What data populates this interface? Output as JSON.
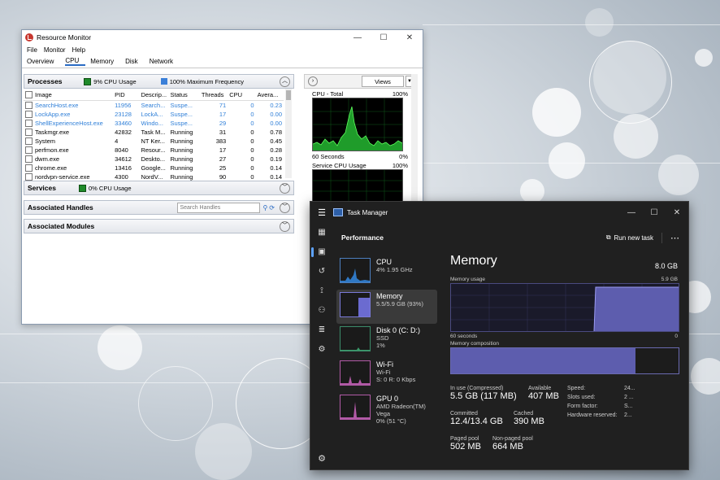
{
  "resource_monitor": {
    "title": "Resource Monitor",
    "window_buttons": [
      "—",
      "☐",
      "✕"
    ],
    "menu": [
      "File",
      "Monitor",
      "Help"
    ],
    "tabs": [
      "Overview",
      "CPU",
      "Memory",
      "Disk",
      "Network"
    ],
    "active_tab": "CPU",
    "processes": {
      "label": "Processes",
      "cpu_usage": "9% CPU Usage",
      "max_freq": "100% Maximum Frequency",
      "columns": [
        "Image",
        "PID",
        "Descrip...",
        "Status",
        "Threads",
        "CPU",
        "Avera..."
      ],
      "rows": [
        {
          "image": "SearchHost.exe",
          "pid": "11956",
          "desc": "Search...",
          "status": "Suspe...",
          "threads": "71",
          "cpu": "0",
          "avg": "0.23",
          "suspended": true
        },
        {
          "image": "LockApp.exe",
          "pid": "23128",
          "desc": "LockA...",
          "status": "Suspe...",
          "threads": "17",
          "cpu": "0",
          "avg": "0.00",
          "suspended": true
        },
        {
          "image": "ShellExperienceHost.exe",
          "pid": "33460",
          "desc": "Windo...",
          "status": "Suspe...",
          "threads": "29",
          "cpu": "0",
          "avg": "0.00",
          "suspended": true
        },
        {
          "image": "Taskmgr.exe",
          "pid": "42832",
          "desc": "Task M...",
          "status": "Running",
          "threads": "31",
          "cpu": "0",
          "avg": "0.78",
          "suspended": false
        },
        {
          "image": "System",
          "pid": "4",
          "desc": "NT Ker...",
          "status": "Running",
          "threads": "383",
          "cpu": "0",
          "avg": "0.45",
          "suspended": false
        },
        {
          "image": "perfmon.exe",
          "pid": "8040",
          "desc": "Resour...",
          "status": "Running",
          "threads": "17",
          "cpu": "0",
          "avg": "0.28",
          "suspended": false
        },
        {
          "image": "dwm.exe",
          "pid": "34612",
          "desc": "Deskto...",
          "status": "Running",
          "threads": "27",
          "cpu": "0",
          "avg": "0.19",
          "suspended": false
        },
        {
          "image": "chrome.exe",
          "pid": "13416",
          "desc": "Google...",
          "status": "Running",
          "threads": "25",
          "cpu": "0",
          "avg": "0.14",
          "suspended": false
        },
        {
          "image": "nordvpn-service.exe",
          "pid": "4300",
          "desc": "NordV...",
          "status": "Running",
          "threads": "90",
          "cpu": "0",
          "avg": "0.14",
          "suspended": false
        }
      ]
    },
    "services": {
      "label": "Services",
      "cpu_usage": "0% CPU Usage"
    },
    "handles": {
      "label": "Associated Handles",
      "search_placeholder": "Search Handles"
    },
    "modules": {
      "label": "Associated Modules"
    },
    "right_panel": {
      "views_label": "Views",
      "cpu_total": {
        "label": "CPU - Total",
        "max": "100%",
        "time": "60 Seconds",
        "min": "0%"
      },
      "service_cpu": {
        "label": "Service CPU Usage",
        "max": "100%"
      }
    }
  },
  "task_manager": {
    "title": "Task Manager",
    "window_buttons": [
      "—",
      "☐",
      "✕"
    ],
    "section": "Performance",
    "run_new_task": "Run new task",
    "items": [
      {
        "name": "CPU",
        "line1": "4% 1.95 GHz",
        "line2": "",
        "color": "#3d8bd8"
      },
      {
        "name": "Memory",
        "line1": "5.5/5.9 GB (93%)",
        "line2": "",
        "color": "#7a7ad8"
      },
      {
        "name": "Disk 0 (C: D:)",
        "line1": "SSD",
        "line2": "1%",
        "color": "#3b9a6a"
      },
      {
        "name": "Wi-Fi",
        "line1": "Wi-Fi",
        "line2": "S: 0 R: 0 Kbps",
        "color": "#c86ab8"
      },
      {
        "name": "GPU 0",
        "line1": "AMD Radeon(TM) Vega",
        "line2": "0% (51 °C)",
        "color": "#c86ab8"
      }
    ],
    "selected": "Memory",
    "memory": {
      "title": "Memory",
      "total": "8.0 GB",
      "usage_label": "Memory usage",
      "usage_max": "5.9 GB",
      "time_label": "60 seconds",
      "time_min": "0",
      "composition_label": "Memory composition",
      "in_use_label": "In use (Compressed)",
      "in_use": "5.5 GB (117 MB)",
      "available_label": "Available",
      "available": "407 MB",
      "committed_label": "Committed",
      "committed": "12.4/13.4 GB",
      "cached_label": "Cached",
      "cached": "390 MB",
      "paged_label": "Paged pool",
      "paged": "502 MB",
      "nonpaged_label": "Non-paged pool",
      "nonpaged": "664 MB",
      "speed_label": "Speed:",
      "speed": "24...",
      "slots_label": "Slots used:",
      "slots": "2 ...",
      "form_label": "Form factor:",
      "form": "S...",
      "hwres_label": "Hardware reserved:",
      "hwres": "2..."
    }
  }
}
